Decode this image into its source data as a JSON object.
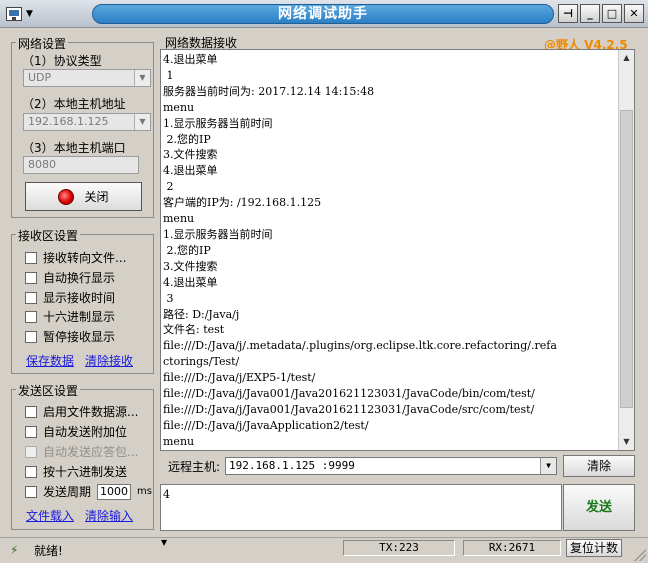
{
  "window": {
    "title": "网络调试助手",
    "version": "@野人 V4.2.5"
  },
  "network": {
    "group_title": "网络设置",
    "protocol_label": "（1）协议类型",
    "protocol_value": "UDP",
    "host_label": "（2）本地主机地址",
    "host_value": "192.168.1.125",
    "port_label": "（3）本地主机端口",
    "port_value": "8080",
    "close_button": "关闭"
  },
  "receive_settings": {
    "group_title": "接收区设置",
    "options": [
      {
        "label": "接收转向文件...",
        "checked": false,
        "disabled": false
      },
      {
        "label": "自动换行显示",
        "checked": false,
        "disabled": false
      },
      {
        "label": "显示接收时间",
        "checked": false,
        "disabled": false
      },
      {
        "label": "十六进制显示",
        "checked": false,
        "disabled": false
      },
      {
        "label": "暂停接收显示",
        "checked": false,
        "disabled": false
      }
    ],
    "save_link": "保存数据",
    "clear_link": "清除接收"
  },
  "send_settings": {
    "group_title": "发送区设置",
    "options": [
      {
        "label": "启用文件数据源...",
        "checked": false,
        "disabled": false
      },
      {
        "label": "自动发送附加位",
        "checked": false,
        "disabled": false
      },
      {
        "label": "自动发送应答包...",
        "checked": false,
        "disabled": true
      },
      {
        "label": "按十六进制发送",
        "checked": false,
        "disabled": false
      }
    ],
    "period_label": "发送周期",
    "period_value": "1000",
    "period_unit": "ms",
    "load_link": "文件载入",
    "clear_link": "清除输入"
  },
  "receive_area": {
    "title": "网络数据接收",
    "text": "4.退出菜单\n 1\n服务器当前时间为: 2017.12.14 14:15:48\nmenu\n1.显示服务器当前时间\n 2.您的IP\n3.文件搜索\n4.退出菜单\n 2\n客户端的IP为: /192.168.1.125\nmenu\n1.显示服务器当前时间\n 2.您的IP\n3.文件搜索\n4.退出菜单\n 3\n路径: D:/Java/j\n文件名: test\nfile:///D:/Java/j/.metadata/.plugins/org.eclipse.ltk.core.refactoring/.refa\nctorings/Test/\nfile:///D:/Java/j/EXP5-1/test/\nfile:///D:/Java/j/Java001/Java201621123031/JavaCode/bin/com/test/\nfile:///D:/Java/j/Java001/Java201621123031/JavaCode/src/com/test/\nfile:///D:/Java/j/JavaApplication2/test/\nmenu"
  },
  "remote": {
    "label": "远程主机:",
    "value": "192.168.1.125 :9999",
    "clear_button": "清除"
  },
  "send_area": {
    "text": "4",
    "send_button": "发送"
  },
  "status": {
    "text": "就绪!",
    "tx": "TX:223",
    "rx": "RX:2671",
    "reset_button": "复位计数"
  }
}
